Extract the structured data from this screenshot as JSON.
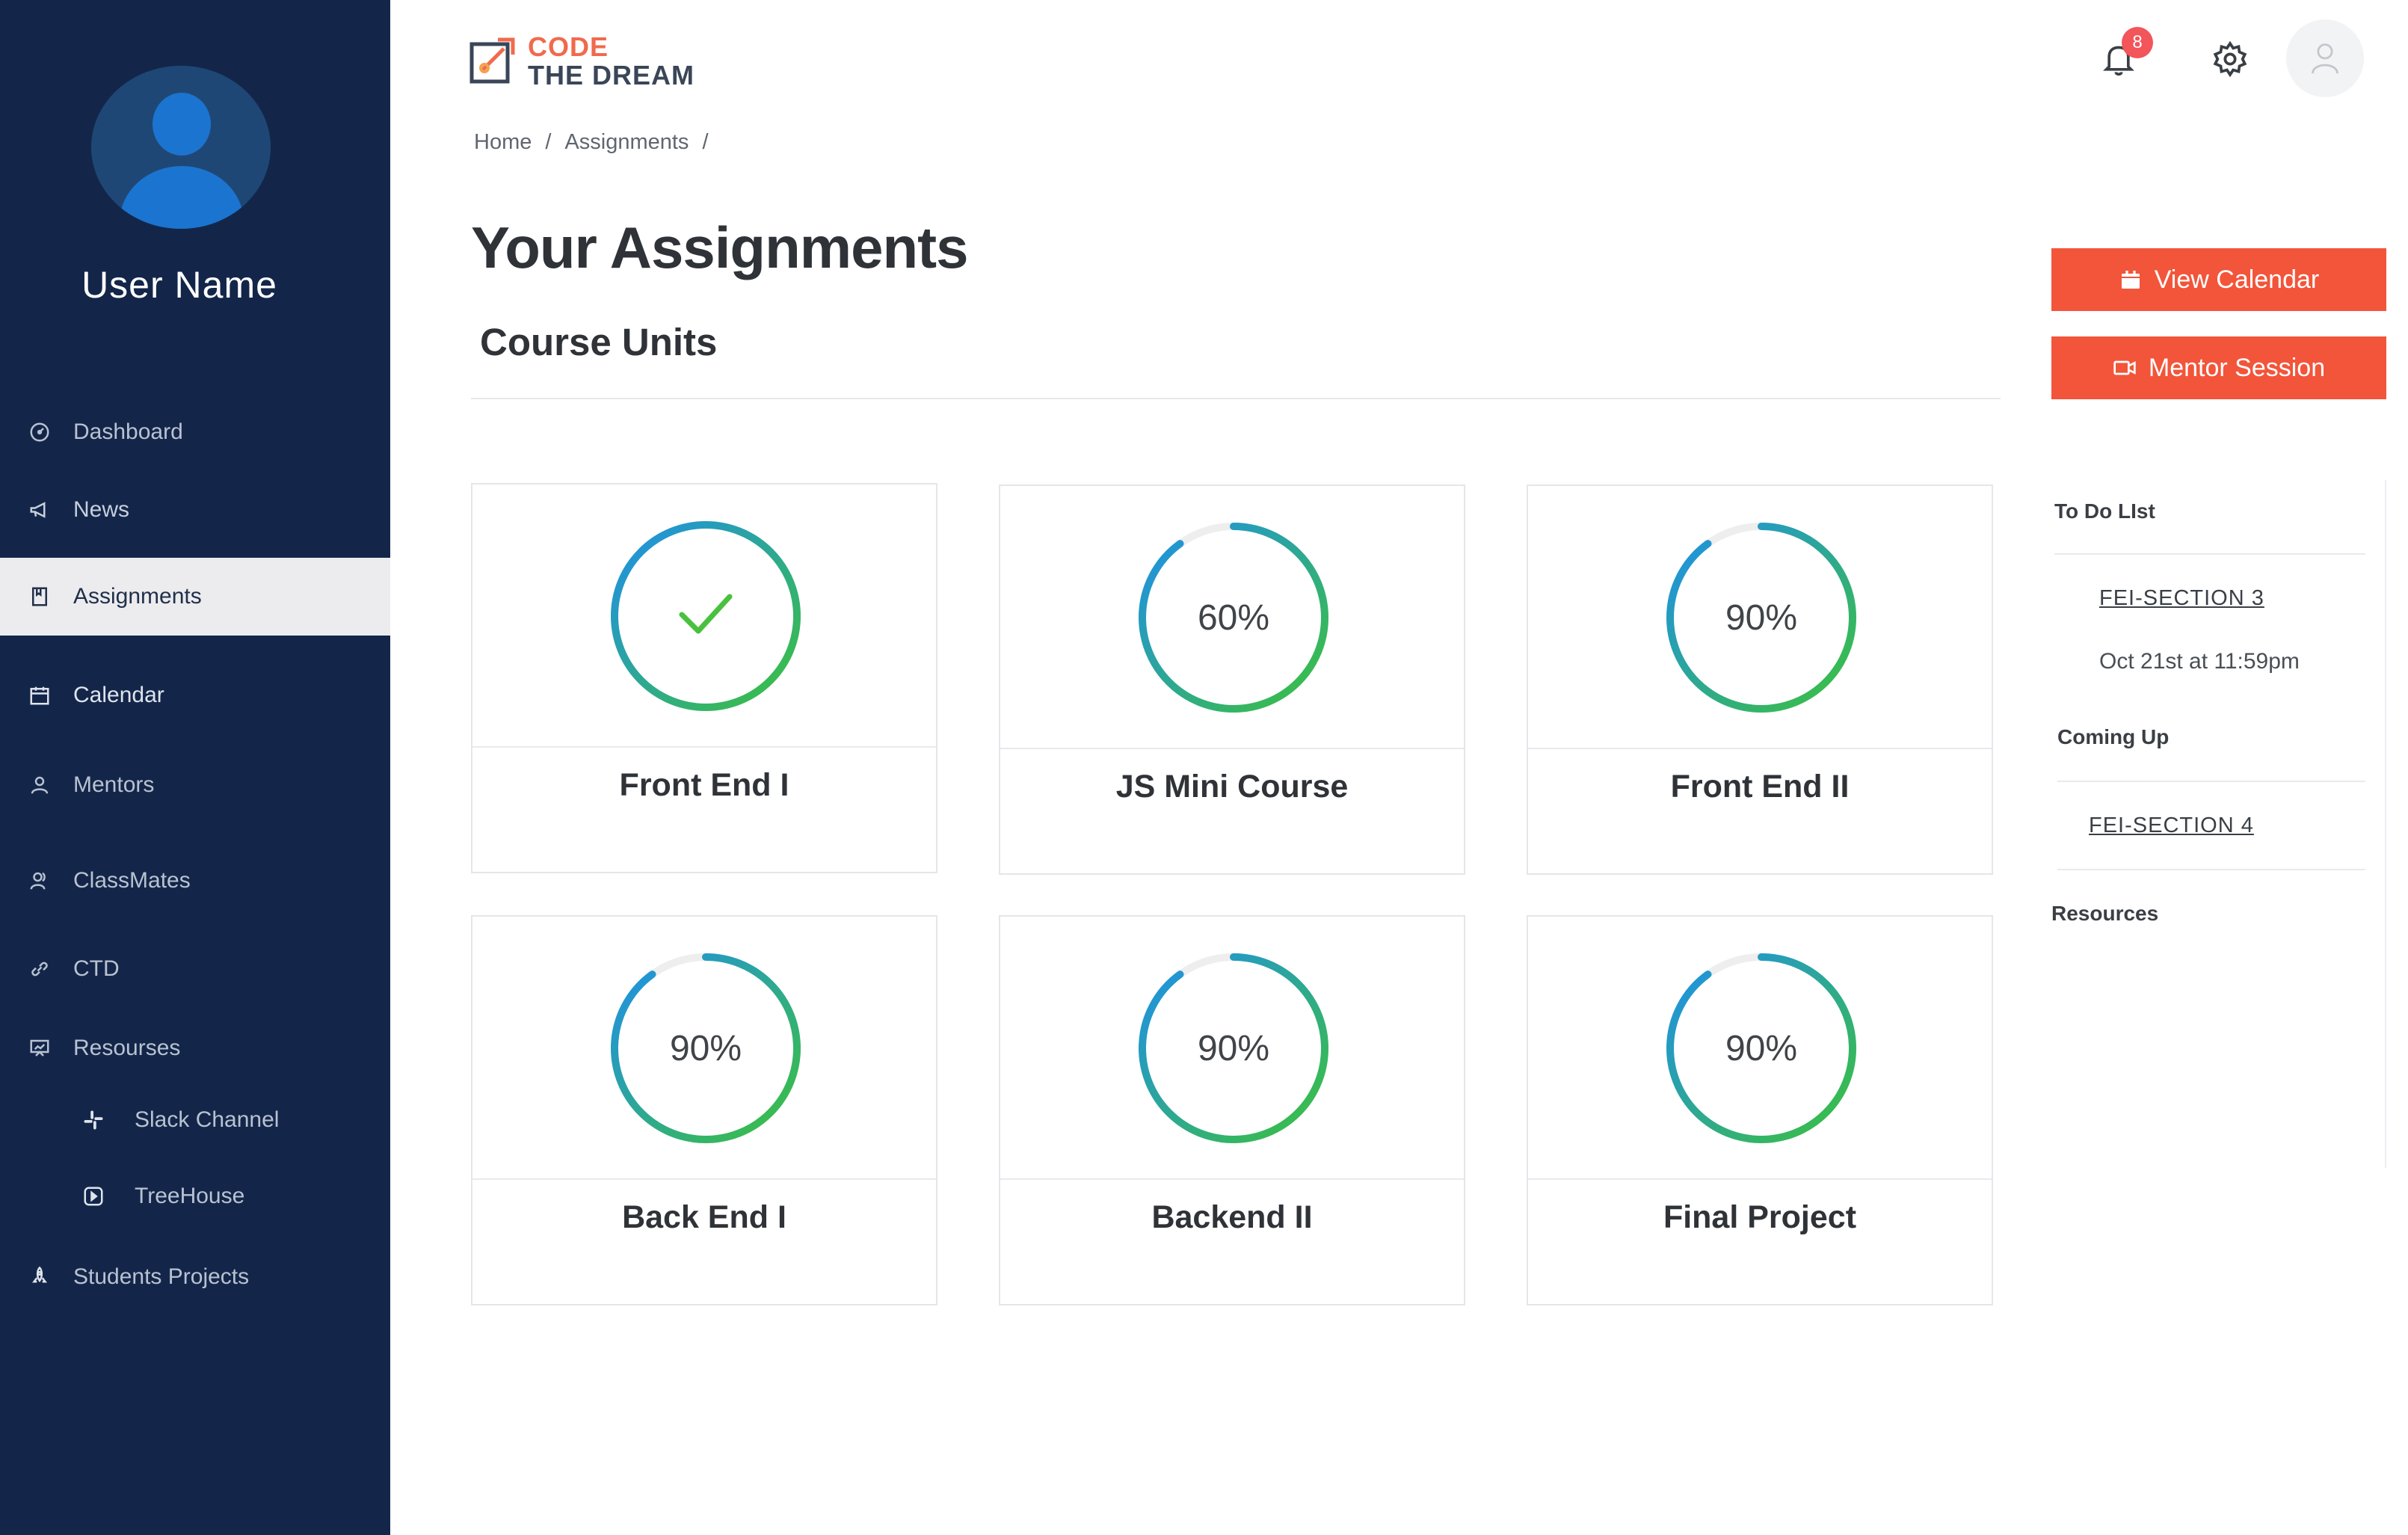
{
  "user": {
    "name": "User Name"
  },
  "nav": {
    "dashboard": "Dashboard",
    "news": "News",
    "assignments": "Assignments",
    "calendar": "Calendar",
    "mentors": "Mentors",
    "classmates": "ClassMates",
    "ctd": "CTD",
    "resources": "Resourses",
    "slack": "Slack Channel",
    "treehouse": "TreeHouse",
    "students_projects": "Students Projects"
  },
  "logo": {
    "line1": "CODE",
    "line2": "THE DREAM"
  },
  "header": {
    "notification_count": "8"
  },
  "breadcrumb": {
    "home": "Home",
    "sep1": "/",
    "assignments": "Assignments",
    "sep2": "/"
  },
  "page": {
    "title": "Your Assignments",
    "section": "Course Units"
  },
  "cards": [
    {
      "title": "Front End I",
      "progress": 1.0,
      "display": "",
      "complete": true
    },
    {
      "title": "JS Mini Course",
      "progress": 0.9,
      "display": "60%",
      "complete": false
    },
    {
      "title": "Front End II",
      "progress": 0.9,
      "display": "90%",
      "complete": false
    },
    {
      "title": "Back End I",
      "progress": 0.9,
      "display": "90%",
      "complete": false
    },
    {
      "title": "Backend II",
      "progress": 0.9,
      "display": "90%",
      "complete": false
    },
    {
      "title": "Final Project",
      "progress": 0.9,
      "display": "90%",
      "complete": false
    }
  ],
  "actions": {
    "view_calendar": "View Calendar",
    "mentor_session": "Mentor Session"
  },
  "todo": {
    "heading": "To Do LIst",
    "item": "FEI-SECTION 3",
    "item_date": "Oct 21st at 11:59pm",
    "coming_heading": "Coming Up",
    "coming_item": "FEI-SECTION 4",
    "resources_heading": "Resources"
  },
  "colors": {
    "sidebar": "#13264a",
    "accent": "#f2553a",
    "ring_start": "#3cc13b",
    "ring_end": "#1e8fea",
    "badge": "#f2555a"
  }
}
